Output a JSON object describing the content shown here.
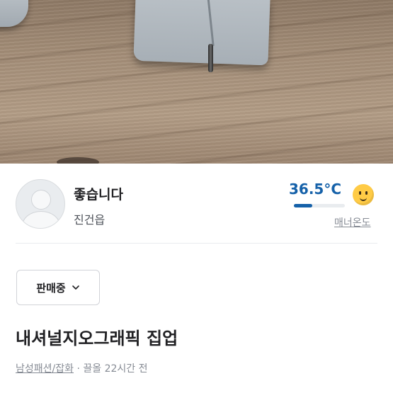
{
  "seller": {
    "nickname": "좋습니다",
    "region": "진건읍",
    "temperature": "36.5°C",
    "temperature_level": 0.365,
    "manner_label": "매너온도"
  },
  "product": {
    "status_label": "판매중",
    "title": "내셔널지오그래픽 집업",
    "category": "남성패션/잡화",
    "separator": " · ",
    "posted": "끌올 22시간 전"
  },
  "colors": {
    "temperature": "#1561a9",
    "text_primary": "#212124",
    "text_secondary": "#868b94"
  },
  "icons": {
    "status_dropdown": "chevron-down-icon",
    "manner_face": "smile-face-icon",
    "avatar": "default-profile-icon"
  }
}
